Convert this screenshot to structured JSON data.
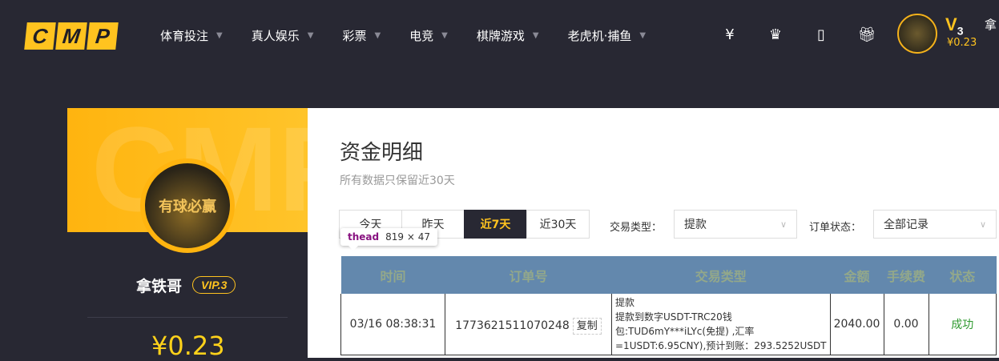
{
  "header": {
    "logo": [
      "C",
      "M",
      "P"
    ],
    "nav": [
      {
        "label": "体育投注"
      },
      {
        "label": "真人娱乐"
      },
      {
        "label": "彩票"
      },
      {
        "label": "电竞"
      },
      {
        "label": "棋牌游戏"
      },
      {
        "label": "老虎机·捕鱼"
      }
    ],
    "icons": [
      "yen-ticket-icon",
      "crown-icon",
      "tablet-icon",
      "gift-icon"
    ],
    "vip_level": "V",
    "vip_num": "3",
    "balance": "¥0.23",
    "username": "拿"
  },
  "sidebar": {
    "watermark": "CMP",
    "avatar_text": "有球必赢",
    "username": "拿铁哥",
    "vip": "VIP.3",
    "balance": "¥0.23"
  },
  "main": {
    "title": "资金明细",
    "subtitle": "所有数据只保留近30天",
    "tabs": [
      {
        "label": "今天"
      },
      {
        "label": "昨天"
      },
      {
        "label": "近7天",
        "active": true
      },
      {
        "label": "近30天"
      }
    ],
    "type_label": "交易类型：",
    "type_value": "提款",
    "status_label": "订单状态：",
    "status_value": "全部记录",
    "table": {
      "headers": [
        "时间",
        "订单号",
        "交易类型",
        "金额",
        "手续费",
        "状态"
      ],
      "rows": [
        {
          "time": "03/16 08:38:31",
          "order": "1773621511070248",
          "copy": "复制",
          "type_lines": [
            "提款",
            "提款到数字USDT-TRC20钱",
            "包:TUD6mY***iLYc(免提) ,汇率",
            "=1USDT:6.95CNY),预计到账：293.5252USDT"
          ],
          "amount": "2040.00",
          "fee": "0.00",
          "status": "成功"
        }
      ]
    }
  },
  "tooltip": {
    "tag": "thead",
    "size": "819 × 47"
  },
  "colors": {
    "accent": "#ffc31f",
    "background": "#282833",
    "table_header": "#6388ad",
    "success": "#2f9a2f"
  }
}
